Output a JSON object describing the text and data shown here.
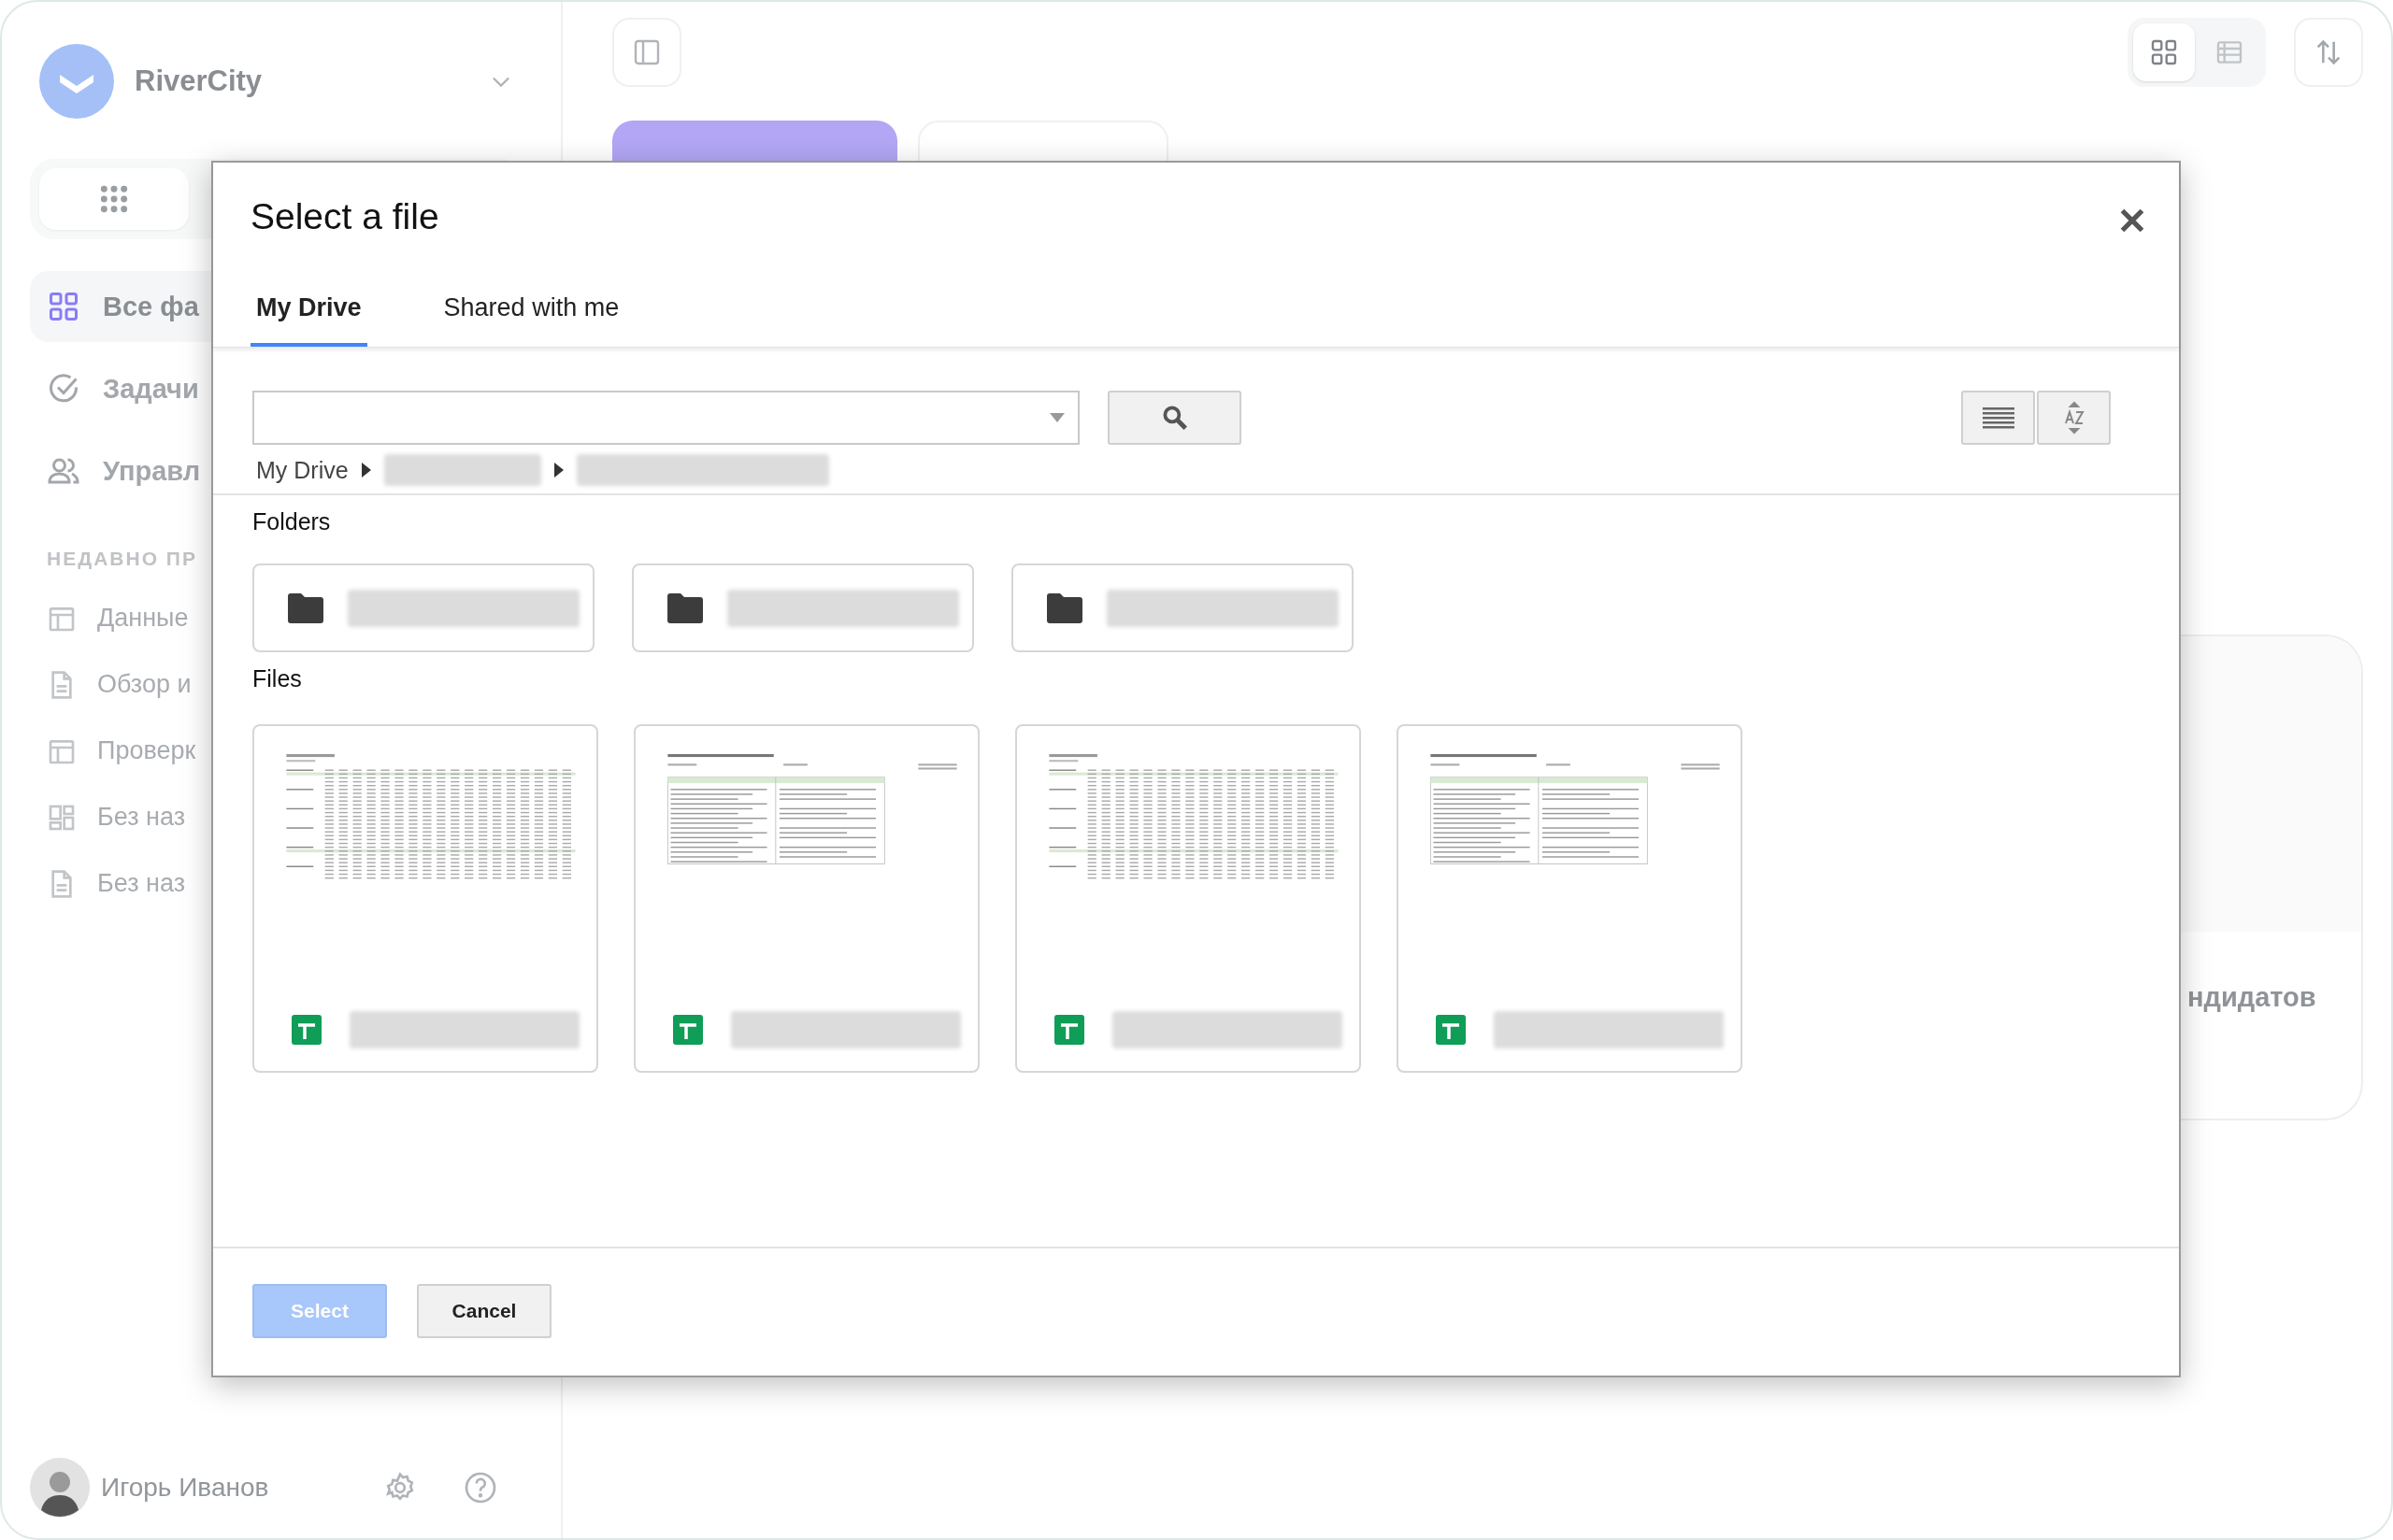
{
  "sidebar": {
    "brand": "RiverCity",
    "nav": [
      {
        "label": "Все фа",
        "kind": "grid",
        "selected": true
      },
      {
        "label": "Задачи",
        "kind": "check",
        "selected": false
      },
      {
        "label": "Управл",
        "kind": "people",
        "selected": false
      }
    ],
    "recent_header": "НЕДАВНО ПР",
    "recent": [
      {
        "label": "Данные",
        "kind": "table"
      },
      {
        "label": "Обзор и",
        "kind": "doc"
      },
      {
        "label": "Проверк",
        "kind": "table"
      },
      {
        "label": "Без наз",
        "kind": "board"
      },
      {
        "label": "Без наз",
        "kind": "doc"
      }
    ],
    "user": {
      "name": "Игорь Иванов"
    }
  },
  "main": {
    "view_toggle": [
      {
        "kind": "grid",
        "selected": true
      },
      {
        "kind": "list",
        "selected": false
      }
    ],
    "card": {
      "title": "ндидатов"
    }
  },
  "dialog": {
    "title": "Select a file",
    "tabs": [
      {
        "label": "My Drive",
        "selected": true
      },
      {
        "label": "Shared with me",
        "selected": false
      }
    ],
    "breadcrumb": {
      "root": "My Drive"
    },
    "folders_heading": "Folders",
    "folders": [
      {
        "kind": "folder"
      },
      {
        "kind": "folder"
      },
      {
        "kind": "folder"
      }
    ],
    "files_heading": "Files",
    "files": [
      {
        "kind": "grid"
      },
      {
        "kind": "report"
      },
      {
        "kind": "grid"
      },
      {
        "kind": "report"
      }
    ],
    "buttons": [
      {
        "label": "Select",
        "disabled": true
      },
      {
        "label": "Cancel",
        "disabled": false
      }
    ]
  }
}
